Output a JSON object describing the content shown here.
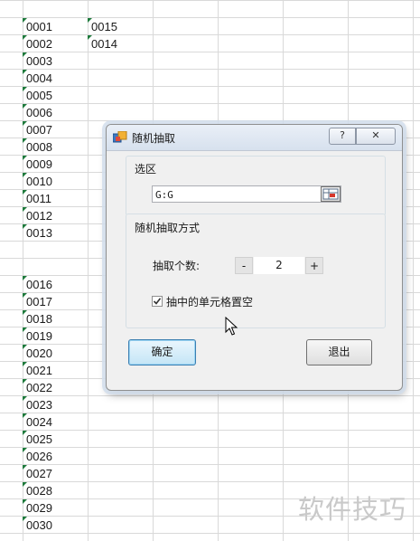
{
  "sheet": {
    "col_a": [
      {
        "row": 1,
        "value": "0001"
      },
      {
        "row": 2,
        "value": "0002"
      },
      {
        "row": 3,
        "value": "0003"
      },
      {
        "row": 4,
        "value": "0004"
      },
      {
        "row": 5,
        "value": "0005"
      },
      {
        "row": 6,
        "value": "0006"
      },
      {
        "row": 7,
        "value": "0007"
      },
      {
        "row": 8,
        "value": "0008"
      },
      {
        "row": 9,
        "value": "0009"
      },
      {
        "row": 10,
        "value": "0010"
      },
      {
        "row": 11,
        "value": "0011"
      },
      {
        "row": 12,
        "value": "0012"
      },
      {
        "row": 13,
        "value": "0013"
      },
      {
        "row": 16,
        "value": "0016"
      },
      {
        "row": 17,
        "value": "0017"
      },
      {
        "row": 18,
        "value": "0018"
      },
      {
        "row": 19,
        "value": "0019"
      },
      {
        "row": 20,
        "value": "0020"
      },
      {
        "row": 21,
        "value": "0021"
      },
      {
        "row": 22,
        "value": "0022"
      },
      {
        "row": 23,
        "value": "0023"
      },
      {
        "row": 24,
        "value": "0024"
      },
      {
        "row": 25,
        "value": "0025"
      },
      {
        "row": 26,
        "value": "0026"
      },
      {
        "row": 27,
        "value": "0027"
      },
      {
        "row": 28,
        "value": "0028"
      },
      {
        "row": 29,
        "value": "0029"
      },
      {
        "row": 30,
        "value": "0030"
      }
    ],
    "col_b": [
      {
        "row": 1,
        "value": "0015"
      },
      {
        "row": 2,
        "value": "0014"
      }
    ]
  },
  "dialog": {
    "title": "随机抽取",
    "help_label": "?",
    "close_label": "✕",
    "selection_group_label": "选区",
    "range_value": "G:G",
    "method_group_label": "随机抽取方式",
    "count_label": "抽取个数:",
    "stepper_minus": "-",
    "count_value": "2",
    "stepper_plus": "+",
    "blank_checkbox_label": "抽中的单元格置空",
    "blank_checkbox_checked": true,
    "ok_label": "确定",
    "exit_label": "退出"
  },
  "watermark": "软件技巧",
  "icons": {
    "app": "app-icon",
    "range_picker": "range-picker-icon",
    "cursor": "mouse-pointer-icon"
  }
}
